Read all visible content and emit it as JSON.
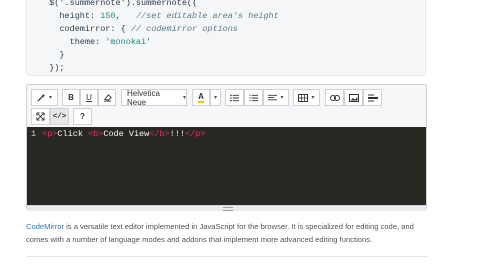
{
  "code_sample": {
    "lines": [
      {
        "pre": "  $('.summernote').summernote({",
        "num": "",
        "str": "",
        "com": ""
      },
      {
        "pre": "    height: ",
        "num": "150",
        "mid": ",   ",
        "com": "//set editable area's height"
      },
      {
        "pre": "    codemirror: { ",
        "com": "// codemirror options"
      },
      {
        "pre": "      theme: ",
        "str": "'monokai'"
      },
      {
        "pre": "    }"
      },
      {
        "pre": "  });"
      }
    ]
  },
  "toolbar": {
    "font_name": "Helvetica Neue",
    "bold": "B",
    "underline": "U",
    "help": "?"
  },
  "editor": {
    "line_number": "1",
    "open_p": "<p>",
    "text1": "Click ",
    "open_b": "<b>",
    "text2": "Code View",
    "close_b": "</b>",
    "text3": "!!!",
    "close_p": "</p>"
  },
  "paragraph": {
    "link": "CodeMirror",
    "text": " is a versatile text editor implemented in JavaScript for the browser. It is specialized for editing code, and comes with a number of language modes and addons that implement more advanced editing functions."
  }
}
